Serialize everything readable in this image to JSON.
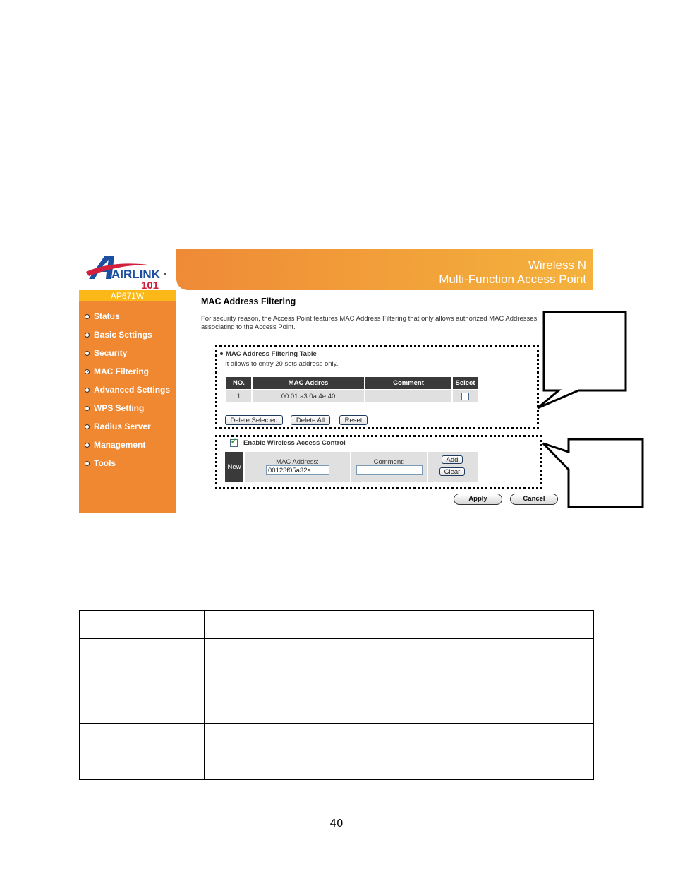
{
  "brand": {
    "logo_text": "AIRLINK",
    "logo_sub": "101",
    "model": "AP671W"
  },
  "banner": {
    "line1": "Wireless N",
    "line2": "Multi-Function Access Point",
    "colors": {
      "start": "#ef8a37",
      "end": "#f4b23c"
    }
  },
  "sidebar": {
    "bg_color": "#f08731",
    "items": [
      {
        "label": "Status",
        "active": false
      },
      {
        "label": "Basic Settings",
        "active": false
      },
      {
        "label": "Security",
        "active": false
      },
      {
        "label": "MAC Filtering",
        "active": true
      },
      {
        "label": "Advanced Settings",
        "active": false
      },
      {
        "label": "WPS Setting",
        "active": false
      },
      {
        "label": "Radius Server",
        "active": false
      },
      {
        "label": "Management",
        "active": false
      },
      {
        "label": "Tools",
        "active": false
      }
    ]
  },
  "main": {
    "title": "MAC Address Filtering",
    "description": "For security reason, the Access Point features MAC Address Filtering that only allows authorized MAC Addresses associating to the Access Point.",
    "filter_table": {
      "title": "MAC Address Filtering Table",
      "subtitle": "It allows to entry 20 sets address only.",
      "columns": [
        "NO.",
        "MAC Addres",
        "Comment",
        "Select"
      ],
      "rows": [
        {
          "no": "1",
          "mac": "00:01:a3:0a:4e:40",
          "comment": "",
          "selected": false
        }
      ],
      "buttons": {
        "delete_selected": "Delete Selected",
        "delete_all": "Delete All",
        "reset": "Reset"
      }
    },
    "access_control": {
      "enable_label": "Enable Wireless Access Control",
      "enabled": true,
      "new_label": "New",
      "mac_label": "MAC Address:",
      "mac_value": "00123f05a32a",
      "comment_label": "Comment:",
      "comment_value": "",
      "add_label": "Add",
      "clear_label": "Clear"
    },
    "apply_label": "Apply",
    "cancel_label": "Cancel"
  },
  "doc_table": {
    "rows": [
      [
        "",
        ""
      ],
      [
        "",
        ""
      ],
      [
        "",
        ""
      ],
      [
        "",
        ""
      ],
      [
        "",
        ""
      ]
    ]
  },
  "page_number": "40"
}
